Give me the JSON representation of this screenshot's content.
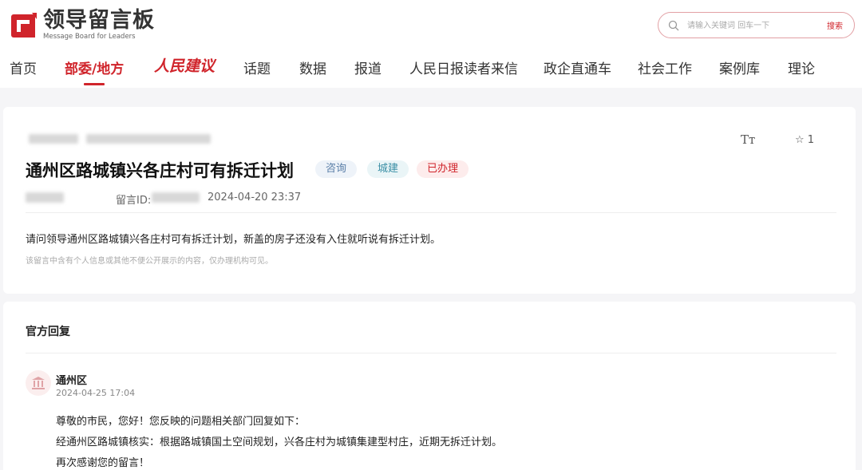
{
  "header": {
    "logo_title": "领导留言板",
    "logo_subtitle": "Message Board for Leaders",
    "search_placeholder": "请输入关键词 回车一下",
    "search_button": "搜索"
  },
  "nav": {
    "items": [
      "首页",
      "部委/地方",
      "人民建议",
      "话题",
      "数据",
      "报道",
      "人民日报读者来信",
      "政企直通车",
      "社会工作",
      "案例库",
      "理论"
    ],
    "active_index": 1
  },
  "message": {
    "title": "通州区路城镇兴各庄村可有拆迁计划",
    "tags": [
      "咨询",
      "城建",
      "已办理"
    ],
    "id_label": "留言ID:",
    "datetime": "2024-04-20 23:37",
    "content": "请问领导通州区路城镇兴各庄村可有拆迁计划，新盖的房子还没有入住就听说有拆迁计划。",
    "privacy_note": "该留言中含有个人信息或其他不便公开展示的内容，仅办理机构可见。",
    "font_size_icon_label": "Tт",
    "favorite_count": "1"
  },
  "reply": {
    "section_title": "官方回复",
    "org_name": "通州区",
    "datetime": "2024-04-25 17:04",
    "lines": [
      "尊敬的市民，您好！您反映的问题相关部门回复如下：",
      "经通州区路城镇核实：根据路城镇国土空间规划，兴各庄村为城镇集建型村庄，近期无拆迁计划。",
      "再次感谢您的留言！"
    ]
  },
  "colors": {
    "accent": "#d0242b",
    "page_bg": "#f5f5f7"
  }
}
